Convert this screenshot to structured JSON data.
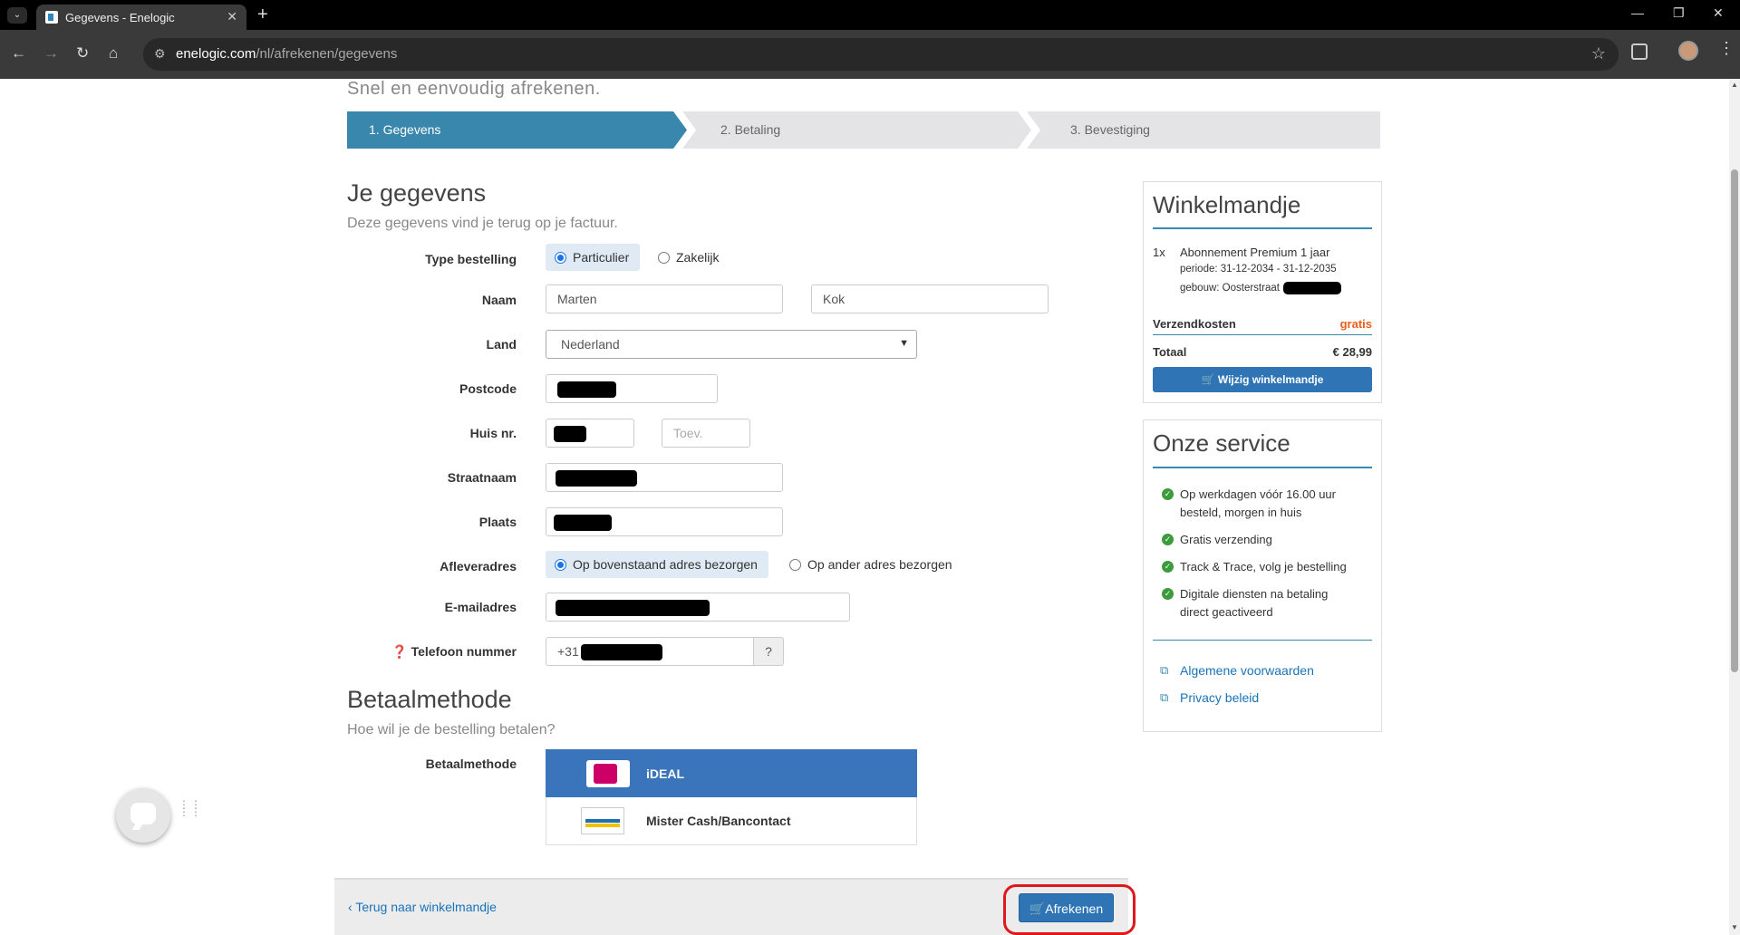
{
  "browser": {
    "tab_title": "Gegevens - Enelogic",
    "url_host": "enelogic.com",
    "url_path": "/nl/afrekenen/gegevens"
  },
  "header": {
    "tagline": "Snel en eenvoudig afrekenen.",
    "steps": [
      "1. Gegevens",
      "2. Betaling",
      "3. Bevestiging"
    ]
  },
  "form": {
    "title": "Je gegevens",
    "subtitle": "Deze gegevens vind je terug op je factuur.",
    "type_label": "Type bestelling",
    "type_options": [
      "Particulier",
      "Zakelijk"
    ],
    "name_label": "Naam",
    "first_name": "Marten",
    "last_name": "Kok",
    "country_label": "Land",
    "country": "Nederland",
    "postcode_label": "Postcode",
    "house_label": "Huis nr.",
    "toev_placeholder": "Toev.",
    "street_label": "Straatnaam",
    "city_label": "Plaats",
    "delivery_label": "Afleveradres",
    "delivery_options": [
      "Op bovenstaand adres bezorgen",
      "Op ander adres bezorgen"
    ],
    "email_label": "E-mailadres",
    "phone_label": "Telefoon nummer",
    "phone_prefix": "+31",
    "phone_help": "?"
  },
  "payment": {
    "title": "Betaalmethode",
    "subtitle": "Hoe wil je de bestelling betalen?",
    "label": "Betaalmethode",
    "methods": [
      "iDEAL",
      "Mister Cash/Bancontact"
    ],
    "selected": "iDEAL"
  },
  "footer": {
    "back": "Terug naar winkelmandje",
    "checkout": "Afrekenen"
  },
  "cart": {
    "title": "Winkelmandje",
    "qty": "1x",
    "product": "Abonnement Premium 1 jaar",
    "period": "periode: 31-12-2034 - 31-12-2035",
    "building": "gebouw: Oosterstraat",
    "shipping_label": "Verzendkosten",
    "shipping_value": "gratis",
    "total_label": "Totaal",
    "total_value": "€ 28,99",
    "edit_button": "Wijzig winkelmandje"
  },
  "service": {
    "title": "Onze service",
    "items": [
      "Op werkdagen vóór 16.00 uur",
      "besteld, morgen in huis",
      "Gratis verzending",
      "Track & Trace, volg je bestelling",
      "Digitale diensten na betaling",
      "direct geactiveerd"
    ],
    "links": [
      "Algemene voorwaarden",
      "Privacy beleid"
    ]
  },
  "colors": {
    "accent": "#3a87ad",
    "button": "#2f75b5",
    "shipping_free": "#e8601c",
    "annotation": "#e0181b"
  }
}
